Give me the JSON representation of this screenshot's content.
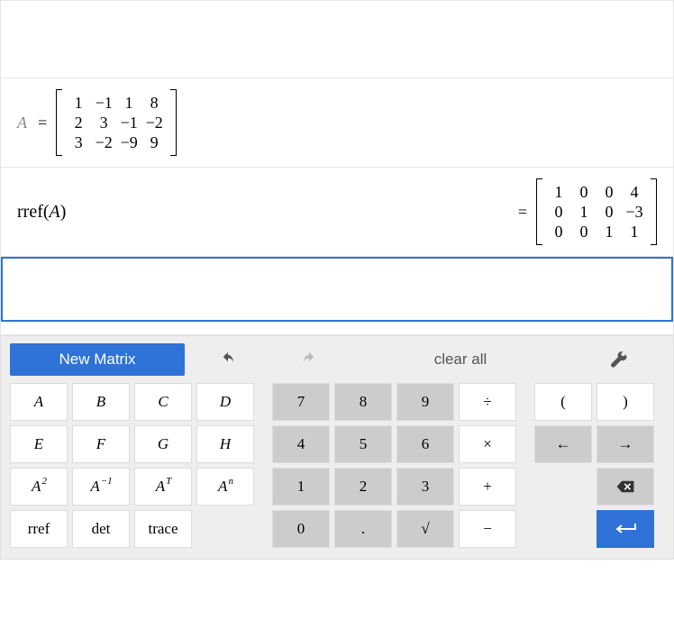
{
  "defs": {
    "A": {
      "name": "A",
      "rows": 3,
      "cols": 4,
      "cells": [
        "1",
        "−1",
        "1",
        "8",
        "2",
        "3",
        "−1",
        "−2",
        "3",
        "−2",
        "−9",
        "9"
      ]
    }
  },
  "result": {
    "call": "rref",
    "arg": "A",
    "rows": 3,
    "cols": 4,
    "cells": [
      "1",
      "0",
      "0",
      "4",
      "0",
      "1",
      "0",
      "−3",
      "0",
      "0",
      "1",
      "1"
    ]
  },
  "toolbar": {
    "new_matrix": "New Matrix",
    "clear_all": "clear all"
  },
  "vars": {
    "r1": [
      "A",
      "B",
      "C",
      "D"
    ],
    "r2": [
      "E",
      "F",
      "G",
      "H"
    ],
    "ops": [
      {
        "base": "A",
        "sup": "2"
      },
      {
        "base": "A",
        "sup": "−1"
      },
      {
        "base": "A",
        "sup": "T"
      },
      {
        "base": "A",
        "sup": "n"
      }
    ],
    "funcs": [
      "rref",
      "det",
      "trace"
    ]
  },
  "nums": {
    "grid": [
      [
        "7",
        "8",
        "9",
        "÷"
      ],
      [
        "4",
        "5",
        "6",
        "×"
      ],
      [
        "1",
        "2",
        "3",
        "+"
      ],
      [
        "0",
        ".",
        "√",
        "−"
      ]
    ]
  },
  "ctrl": {
    "paren_l": "(",
    "paren_r": ")",
    "arr_l": "←",
    "arr_r": "→"
  }
}
